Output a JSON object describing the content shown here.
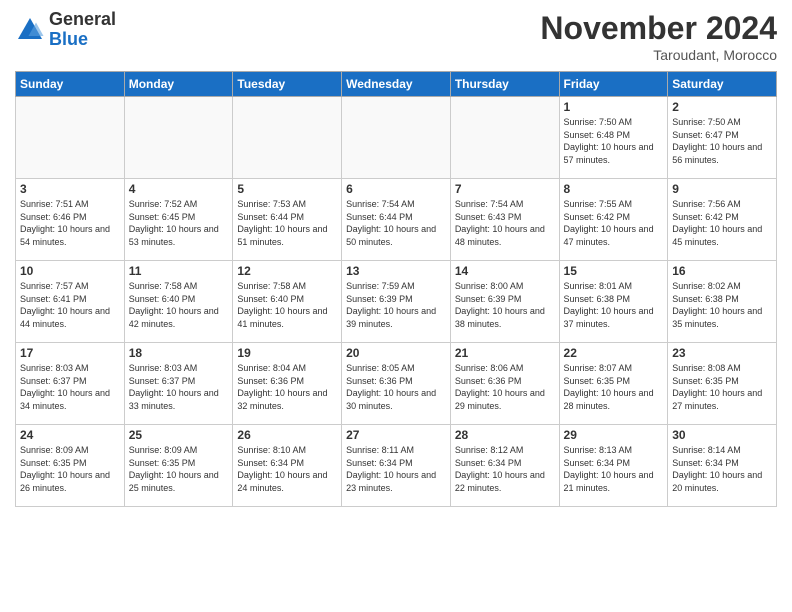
{
  "logo": {
    "general": "General",
    "blue": "Blue"
  },
  "title": "November 2024",
  "location": "Taroudant, Morocco",
  "weekdays": [
    "Sunday",
    "Monday",
    "Tuesday",
    "Wednesday",
    "Thursday",
    "Friday",
    "Saturday"
  ],
  "weeks": [
    [
      {
        "day": "",
        "info": ""
      },
      {
        "day": "",
        "info": ""
      },
      {
        "day": "",
        "info": ""
      },
      {
        "day": "",
        "info": ""
      },
      {
        "day": "",
        "info": ""
      },
      {
        "day": "1",
        "info": "Sunrise: 7:50 AM\nSunset: 6:48 PM\nDaylight: 10 hours and 57 minutes."
      },
      {
        "day": "2",
        "info": "Sunrise: 7:50 AM\nSunset: 6:47 PM\nDaylight: 10 hours and 56 minutes."
      }
    ],
    [
      {
        "day": "3",
        "info": "Sunrise: 7:51 AM\nSunset: 6:46 PM\nDaylight: 10 hours and 54 minutes."
      },
      {
        "day": "4",
        "info": "Sunrise: 7:52 AM\nSunset: 6:45 PM\nDaylight: 10 hours and 53 minutes."
      },
      {
        "day": "5",
        "info": "Sunrise: 7:53 AM\nSunset: 6:44 PM\nDaylight: 10 hours and 51 minutes."
      },
      {
        "day": "6",
        "info": "Sunrise: 7:54 AM\nSunset: 6:44 PM\nDaylight: 10 hours and 50 minutes."
      },
      {
        "day": "7",
        "info": "Sunrise: 7:54 AM\nSunset: 6:43 PM\nDaylight: 10 hours and 48 minutes."
      },
      {
        "day": "8",
        "info": "Sunrise: 7:55 AM\nSunset: 6:42 PM\nDaylight: 10 hours and 47 minutes."
      },
      {
        "day": "9",
        "info": "Sunrise: 7:56 AM\nSunset: 6:42 PM\nDaylight: 10 hours and 45 minutes."
      }
    ],
    [
      {
        "day": "10",
        "info": "Sunrise: 7:57 AM\nSunset: 6:41 PM\nDaylight: 10 hours and 44 minutes."
      },
      {
        "day": "11",
        "info": "Sunrise: 7:58 AM\nSunset: 6:40 PM\nDaylight: 10 hours and 42 minutes."
      },
      {
        "day": "12",
        "info": "Sunrise: 7:58 AM\nSunset: 6:40 PM\nDaylight: 10 hours and 41 minutes."
      },
      {
        "day": "13",
        "info": "Sunrise: 7:59 AM\nSunset: 6:39 PM\nDaylight: 10 hours and 39 minutes."
      },
      {
        "day": "14",
        "info": "Sunrise: 8:00 AM\nSunset: 6:39 PM\nDaylight: 10 hours and 38 minutes."
      },
      {
        "day": "15",
        "info": "Sunrise: 8:01 AM\nSunset: 6:38 PM\nDaylight: 10 hours and 37 minutes."
      },
      {
        "day": "16",
        "info": "Sunrise: 8:02 AM\nSunset: 6:38 PM\nDaylight: 10 hours and 35 minutes."
      }
    ],
    [
      {
        "day": "17",
        "info": "Sunrise: 8:03 AM\nSunset: 6:37 PM\nDaylight: 10 hours and 34 minutes."
      },
      {
        "day": "18",
        "info": "Sunrise: 8:03 AM\nSunset: 6:37 PM\nDaylight: 10 hours and 33 minutes."
      },
      {
        "day": "19",
        "info": "Sunrise: 8:04 AM\nSunset: 6:36 PM\nDaylight: 10 hours and 32 minutes."
      },
      {
        "day": "20",
        "info": "Sunrise: 8:05 AM\nSunset: 6:36 PM\nDaylight: 10 hours and 30 minutes."
      },
      {
        "day": "21",
        "info": "Sunrise: 8:06 AM\nSunset: 6:36 PM\nDaylight: 10 hours and 29 minutes."
      },
      {
        "day": "22",
        "info": "Sunrise: 8:07 AM\nSunset: 6:35 PM\nDaylight: 10 hours and 28 minutes."
      },
      {
        "day": "23",
        "info": "Sunrise: 8:08 AM\nSunset: 6:35 PM\nDaylight: 10 hours and 27 minutes."
      }
    ],
    [
      {
        "day": "24",
        "info": "Sunrise: 8:09 AM\nSunset: 6:35 PM\nDaylight: 10 hours and 26 minutes."
      },
      {
        "day": "25",
        "info": "Sunrise: 8:09 AM\nSunset: 6:35 PM\nDaylight: 10 hours and 25 minutes."
      },
      {
        "day": "26",
        "info": "Sunrise: 8:10 AM\nSunset: 6:34 PM\nDaylight: 10 hours and 24 minutes."
      },
      {
        "day": "27",
        "info": "Sunrise: 8:11 AM\nSunset: 6:34 PM\nDaylight: 10 hours and 23 minutes."
      },
      {
        "day": "28",
        "info": "Sunrise: 8:12 AM\nSunset: 6:34 PM\nDaylight: 10 hours and 22 minutes."
      },
      {
        "day": "29",
        "info": "Sunrise: 8:13 AM\nSunset: 6:34 PM\nDaylight: 10 hours and 21 minutes."
      },
      {
        "day": "30",
        "info": "Sunrise: 8:14 AM\nSunset: 6:34 PM\nDaylight: 10 hours and 20 minutes."
      }
    ]
  ]
}
